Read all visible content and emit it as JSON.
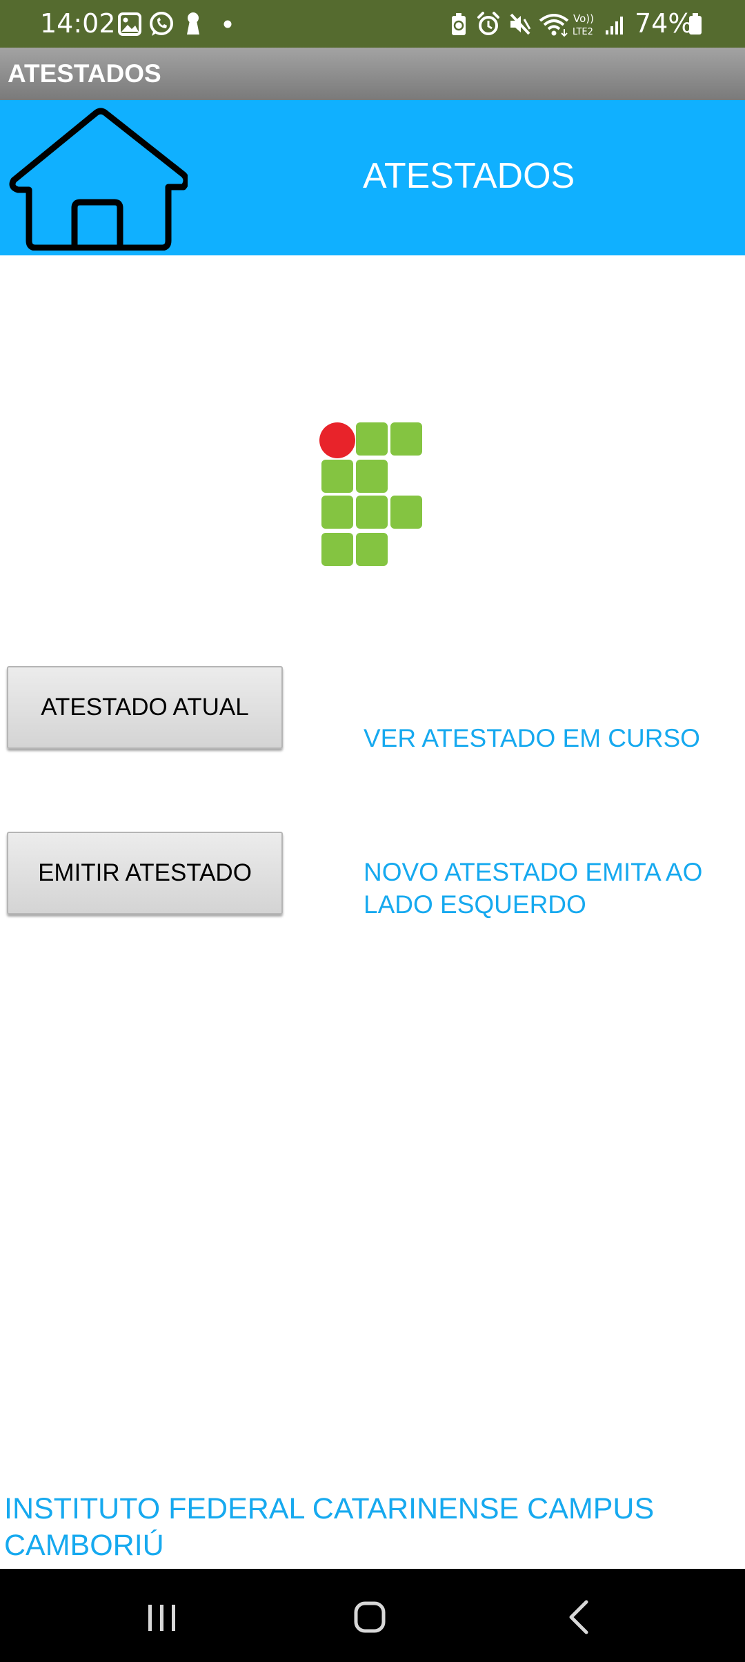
{
  "status_bar": {
    "time": "14:02",
    "battery": "74%",
    "icons": [
      "gallery-icon",
      "whatsapp-icon",
      "keyhole-icon",
      "dot-icon",
      "battery-saver-icon",
      "alarm-icon",
      "mute-icon",
      "wifi-icon",
      "volte-lte2-icon",
      "signal-icon",
      "battery-icon"
    ],
    "network_label": "Vo))\nLTE2",
    "background_color": "#556b2f"
  },
  "action_bar": {
    "title": "ATESTADOS"
  },
  "header": {
    "title": "ATESTADOS",
    "home_icon": "home-icon",
    "background_color": "#10b0ff"
  },
  "logo": {
    "name": "ifc-logo",
    "colors": {
      "dot": "#e8232a",
      "squares": "#84c441"
    }
  },
  "actions": [
    {
      "button_label": "ATESTADO ATUAL",
      "description": "VER ATESTADO EM CURSO"
    },
    {
      "button_label": "EMITIR ATESTADO",
      "description": "NOVO ATESTADO EMITA AO LADO ESQUERDO"
    }
  ],
  "footer": {
    "text": "INSTITUTO FEDERAL CATARINENSE CAMPUS CAMBORIÚ",
    "color": "#16a9ef"
  },
  "nav_bar": {
    "buttons": [
      "recent-apps-icon",
      "home-nav-icon",
      "back-icon"
    ]
  }
}
